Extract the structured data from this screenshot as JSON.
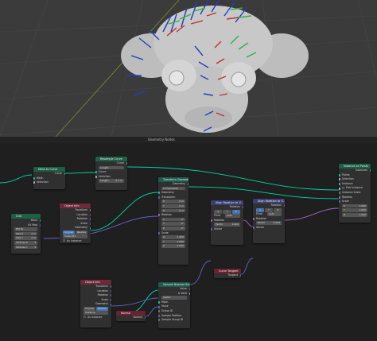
{
  "viewport_header": {
    "label": "Geometry Nodes"
  },
  "nodes": {
    "mesh_to_curve": {
      "title": "Mesh to Curve",
      "out": "Curve",
      "in1": "Mesh",
      "in2": "Selection"
    },
    "resample": {
      "title": "Resample Curve",
      "out": "Curve",
      "mode": "Length",
      "in1": "Curve",
      "in2": "Selection",
      "length_label": "Length",
      "length_value": "0.1 m"
    },
    "transform": {
      "title": "Transform Geometry",
      "out": "Geometry",
      "mode": "Components",
      "in_geo": "Geometry",
      "translation": "Translation",
      "tx": "0 m",
      "ty": "0 m",
      "tz": "0 m",
      "rotation": "Rotation",
      "rx": "0°",
      "ry": "0°",
      "rz": "0°",
      "scale": "Scale",
      "sx": "1.000",
      "sy": "1.000",
      "sz": "1.000"
    },
    "instance": {
      "title": "Instance on Points",
      "out": "Instances",
      "in1": "Points",
      "in2": "Selection",
      "in3": "Instance",
      "in4": "Pick Instance",
      "in5": "Instance Index",
      "in6": "Rotation",
      "in7": "Scale",
      "s1": "1.000",
      "s2": "1.000",
      "s3": "1.000"
    },
    "object_info1": {
      "title": "Object Info",
      "o1": "Transform",
      "o2": "Location",
      "o3": "Rotation",
      "o4": "Scale",
      "o5": "Geometry",
      "btn1": "Original",
      "btn2": "Relative",
      "obj": "Cube.013",
      "as_inst": "As Instance"
    },
    "grid": {
      "title": "Grid",
      "o1": "Mesh",
      "o2": "UV Map",
      "size_x": "Size X",
      "size_y": "Size Y",
      "vx": "Vertices X",
      "vy": "Vertices Y",
      "i1": "2 m",
      "i2": "2 m",
      "i3": "3",
      "i4": "3",
      "mode": "Pfd Ty..."
    },
    "align1": {
      "title": "Align Rotation to V...",
      "out": "Rotation",
      "axis_x": "X",
      "axis_y": "Y",
      "axis_z": "Z",
      "pivot": "Pivot",
      "pivot_val": "Auto",
      "in1": "Rotation",
      "in2": "Factor",
      "in3": "Vector",
      "factor_val": "1.000"
    },
    "align2": {
      "title": "Align Rotation to V...",
      "out": "Rotation",
      "axis_x": "X",
      "axis_y": "Y",
      "axis_z": "Z",
      "pivot": "Pivot",
      "pivot_val": "Auto",
      "in1": "Rotation",
      "in2": "Factor",
      "in3": "Vector",
      "factor_val": "1.000"
    },
    "curve_tangent": {
      "title": "Curve Tangent",
      "out": "Tangent"
    },
    "object_info2": {
      "title": "Object Info",
      "o1": "Transform",
      "o2": "Location",
      "o3": "Rotation",
      "o4": "Scale",
      "o5": "Geometry",
      "btn1": "Original",
      "btn2": "Relative",
      "obj": "Suzanne",
      "as_inst": "As Instance"
    },
    "normal": {
      "title": "Normal",
      "out": "Normal"
    },
    "sample_nearest": {
      "title": "Sample Nearest Surf...",
      "o1": "Value",
      "o2": "Is Valid",
      "mode": "Vector",
      "in1": "Mesh",
      "in2": "Value",
      "in3": "Group ID",
      "in4": "Sample Position",
      "in5": "Sample Group ID"
    }
  }
}
